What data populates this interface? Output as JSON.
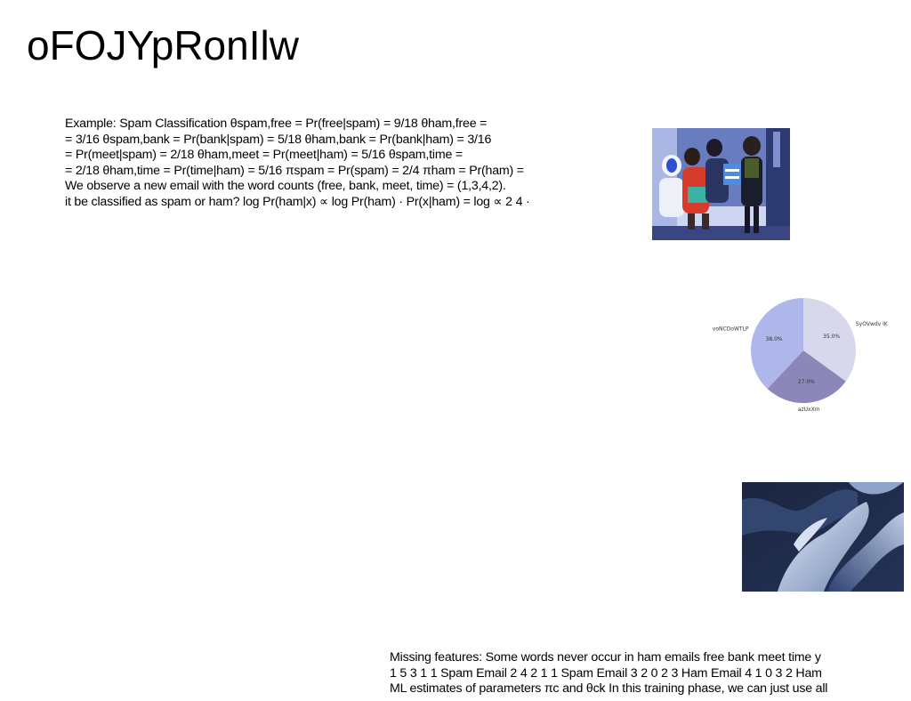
{
  "page": {
    "title": "oFOJYpRonIlw"
  },
  "text_top": {
    "lines": [
      "Example: Spam Classification θspam,free = Pr(free|spam) = 9/18 θham,free =",
      "= 3/16 θspam,bank = Pr(bank|spam) = 5/18 θham,bank = Pr(bank|ham) = 3/16",
      "= Pr(meet|spam) = 2/18 θham,meet = Pr(meet|ham) = 5/16 θspam,time =",
      "= 2/18 θham,time = Pr(time|ham) = 5/16 πspam = Pr(spam) = 2/4 πham = Pr(ham) =",
      "We observe a new email with the word counts (free, bank, meet, time) = (1,3,4,2).",
      "it be classified as spam or ham? log Pr(ham|x) ∝ log Pr(ham) · Pr(x|ham) = log ∝ 2 4 ·"
    ]
  },
  "text_bottom": {
    "lines": [
      "Missing features: Some words never occur in ham emails free bank meet time y",
      "1 5 3 1 1 Spam Email 2 4 2 1 1 Spam Email 3 2 0 2 3 Ham Email 4 1 0 3 2 Ham",
      "ML estimates of parameters πc and θck In this training phase, we can just use all"
    ]
  },
  "images": {
    "people_photo": "photo of a group of people in winter hats",
    "abstract_render": "abstract blue 3D render"
  },
  "chart_data": {
    "type": "pie",
    "title": "",
    "slices": [
      {
        "label": "SyOVwdv IK",
        "value": 35.0,
        "value_label": "35.0%",
        "color": "#d7d8ec"
      },
      {
        "label": "azUxXm",
        "value": 27.0,
        "value_label": "27.0%",
        "color": "#8b87b8"
      },
      {
        "label": "voNCDoWTLP",
        "value": 38.0,
        "value_label": "38.0%",
        "color": "#aeb6ea"
      }
    ],
    "start_angle": "12 o'clock",
    "direction": "clockwise",
    "legend": "none"
  }
}
